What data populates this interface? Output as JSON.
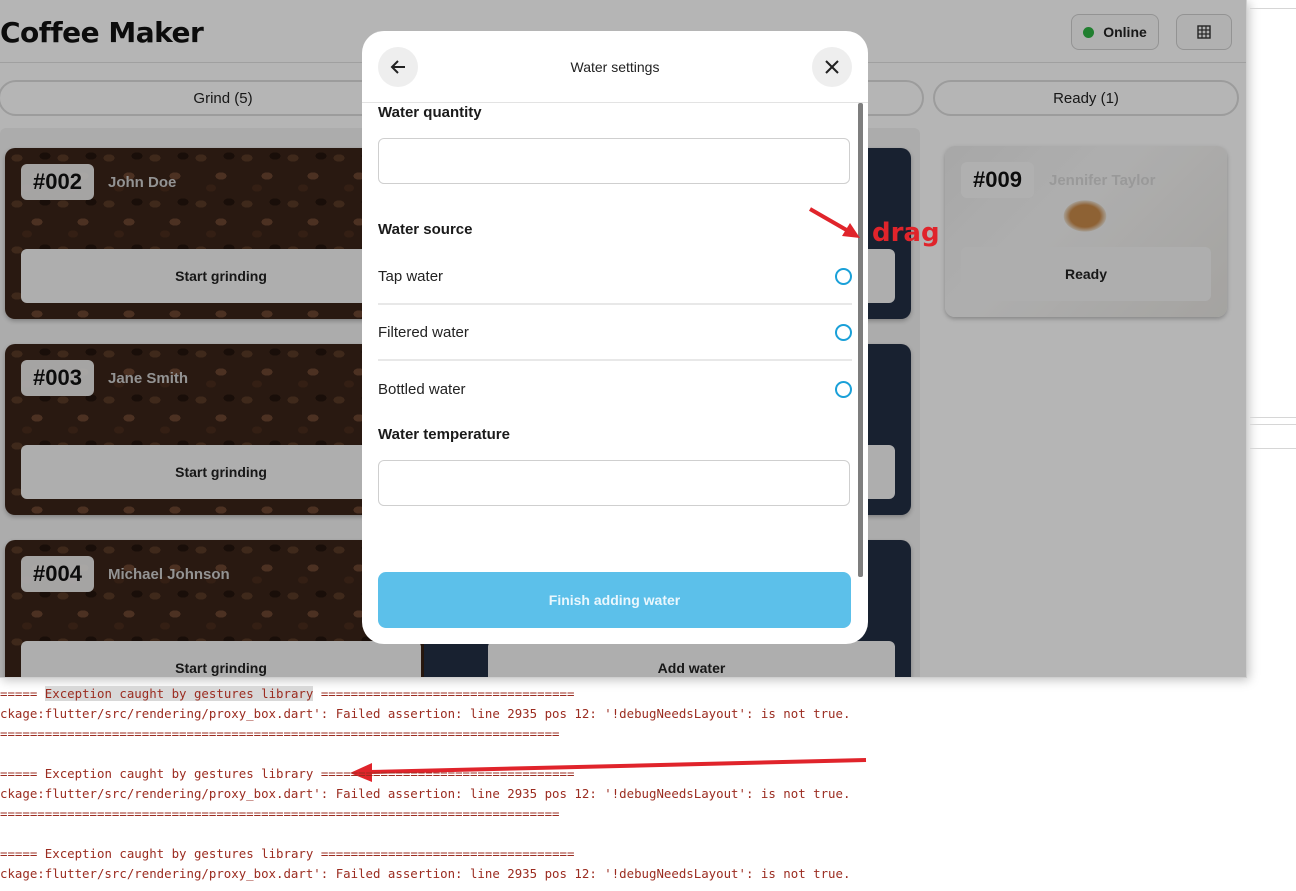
{
  "app": {
    "title": "Coffee Maker",
    "status_label": "Online",
    "status_color": "#2fb344",
    "grid_icon": "grid-icon"
  },
  "tabs": [
    {
      "label": "Grind (5)"
    },
    {
      "label": "Ready (1)"
    }
  ],
  "cards": {
    "grind": [
      {
        "number": "#002",
        "customer": "John Doe",
        "action": "Start grinding"
      },
      {
        "number": "#003",
        "customer": "Jane Smith",
        "action": "Start grinding"
      },
      {
        "number": "#004",
        "customer": "Michael Johnson",
        "action": "Start grinding"
      }
    ],
    "water": [
      {
        "action": "Add water"
      }
    ],
    "ready": [
      {
        "number": "#009",
        "customer": "Jennifer Taylor",
        "action": "Ready"
      }
    ]
  },
  "modal": {
    "title": "Water settings",
    "back_icon": "arrow-left-icon",
    "close_icon": "close-icon",
    "quantity_label": "Water quantity",
    "quantity_value": "",
    "source_label": "Water source",
    "sources": [
      {
        "label": "Tap water",
        "selected": false
      },
      {
        "label": "Filtered water",
        "selected": false
      },
      {
        "label": "Bottled water",
        "selected": false
      }
    ],
    "temperature_label": "Water temperature",
    "temperature_value": "",
    "finish_label": "Finish adding water",
    "accent_color": "#5cc0ea"
  },
  "annotations": {
    "drag_label": "drag",
    "arrow_color": "#e0242b"
  },
  "console": {
    "header_prefix": "=====",
    "header_text": "Exception caught by gestures library",
    "header_suffix": "==================================",
    "error_text": "ckage:flutter/src/rendering/proxy_box.dart': Failed assertion: line 2935 pos 12: '!debugNeedsLayout': is not true.",
    "separator": "==========================================================================="
  }
}
